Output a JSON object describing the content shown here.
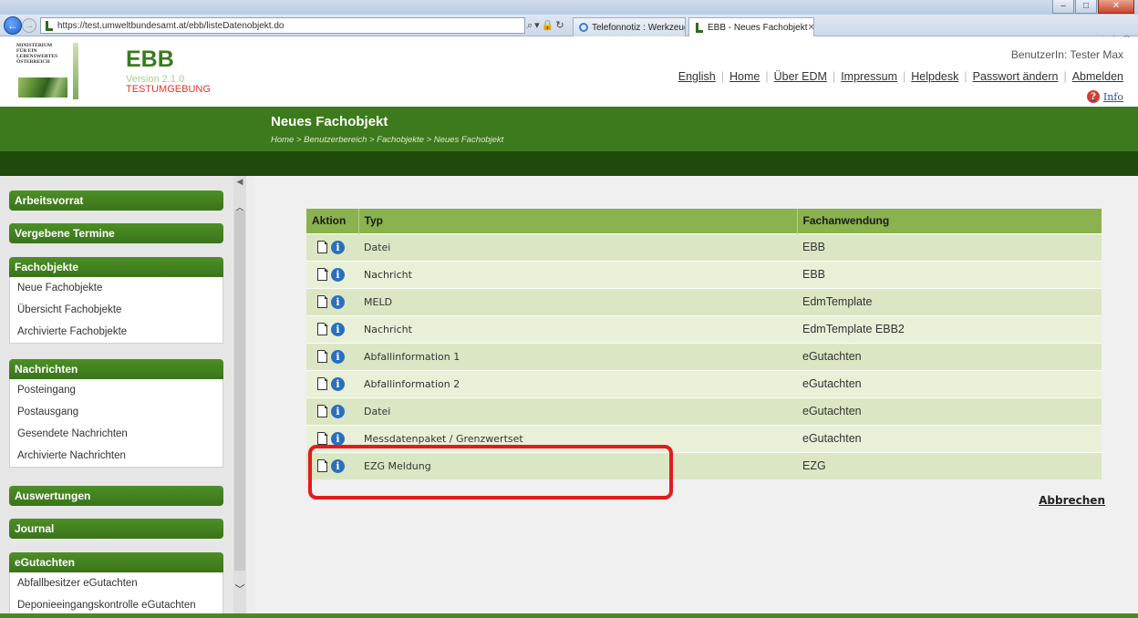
{
  "browser": {
    "url": "https://test.umweltbundesamt.at/ebb/listeDatenobjekt.do",
    "tabs": [
      {
        "label": "Telefonnotiz : Werkzeuge : An..."
      },
      {
        "label": "EBB - Neues Fachobjekt"
      }
    ]
  },
  "header": {
    "ministry_lines": [
      "MINISTERIUM",
      "FÜR EIN",
      "LEBENSWERTES",
      "ÖSTERREICH"
    ],
    "app_title": "EBB",
    "version": "Version 2.1.0",
    "environment": "TESTUMGEBUNG",
    "user_label": "BenutzerIn: Tester Max",
    "links": [
      "English",
      "Home",
      "Über EDM",
      "Impressum",
      "Helpdesk",
      "Passwort ändern",
      "Abmelden"
    ],
    "info_label": "Info"
  },
  "page": {
    "title": "Neues Fachobjekt",
    "breadcrumb": "Home > Benutzerbereich > Fachobjekte > Neues Fachobjekt"
  },
  "sidebar": {
    "groups": [
      {
        "title": "Arbeitsvorrat",
        "items": []
      },
      {
        "title": "Vergebene Termine",
        "items": []
      },
      {
        "title": "Fachobjekte",
        "items": [
          "Neue Fachobjekte",
          "Übersicht Fachobjekte",
          "Archivierte Fachobjekte"
        ]
      },
      {
        "title": "Nachrichten",
        "items": [
          "Posteingang",
          "Postausgang",
          "Gesendete Nachrichten",
          "Archivierte Nachrichten"
        ]
      },
      {
        "title": "Auswertungen",
        "items": []
      },
      {
        "title": "Journal",
        "items": []
      },
      {
        "title": "eGutachten",
        "items": [
          "Abfallbesitzer eGutachten",
          "Deponieeingangskontrolle eGutachten"
        ]
      }
    ]
  },
  "table": {
    "columns": [
      "Aktion",
      "Typ",
      "Fachanwendung"
    ],
    "rows": [
      {
        "typ": "Datei",
        "fachanwendung": "EBB"
      },
      {
        "typ": "Nachricht",
        "fachanwendung": "EBB"
      },
      {
        "typ": "MELD",
        "fachanwendung": "EdmTemplate"
      },
      {
        "typ": "Nachricht",
        "fachanwendung": "EdmTemplate EBB2"
      },
      {
        "typ": "Abfallinformation 1",
        "fachanwendung": "eGutachten"
      },
      {
        "typ": "Abfallinformation 2",
        "fachanwendung": "eGutachten"
      },
      {
        "typ": "Datei",
        "fachanwendung": "eGutachten"
      },
      {
        "typ": "Messdatenpaket / Grenzwertset",
        "fachanwendung": "eGutachten"
      },
      {
        "typ": "EZG Meldung",
        "fachanwendung": "EZG"
      }
    ],
    "highlighted_row": 8
  },
  "actions": {
    "cancel": "Abbrechen"
  },
  "colors": {
    "brand_green": "#3d7a1d",
    "dark_green": "#1f4a0c",
    "table_header": "#8ab24e",
    "highlight_red": "#e31b1b"
  }
}
